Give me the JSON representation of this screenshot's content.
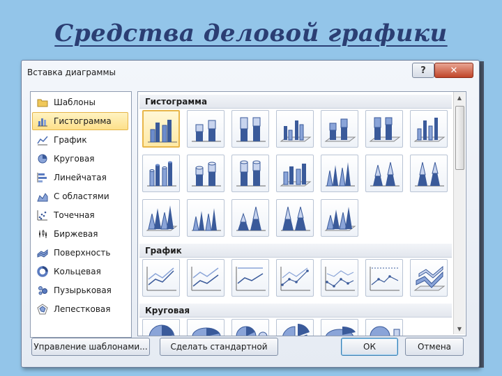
{
  "slide": {
    "title": "Средства деловой графики"
  },
  "dialog": {
    "title": "Вставка диаграммы",
    "help_label": "?",
    "close_label": "✕",
    "categories": [
      {
        "label": "Шаблоны",
        "icon": "folder-icon"
      },
      {
        "label": "Гистограмма",
        "icon": "column-chart-icon",
        "selected": true
      },
      {
        "label": "График",
        "icon": "line-chart-icon"
      },
      {
        "label": "Круговая",
        "icon": "pie-chart-icon"
      },
      {
        "label": "Линейчатая",
        "icon": "bar-chart-icon"
      },
      {
        "label": "С областями",
        "icon": "area-chart-icon"
      },
      {
        "label": "Точечная",
        "icon": "scatter-chart-icon"
      },
      {
        "label": "Биржевая",
        "icon": "stock-chart-icon"
      },
      {
        "label": "Поверхность",
        "icon": "surface-chart-icon"
      },
      {
        "label": "Кольцевая",
        "icon": "doughnut-chart-icon"
      },
      {
        "label": "Пузырьковая",
        "icon": "bubble-chart-icon"
      },
      {
        "label": "Лепестковая",
        "icon": "radar-chart-icon"
      }
    ],
    "sections": [
      {
        "label": "Гистограмма"
      },
      {
        "label": "График"
      },
      {
        "label": "Круговая"
      }
    ],
    "buttons": {
      "manage_templates": "Управление шаблонами...",
      "set_default": "Сделать стандартной",
      "ok": "ОК",
      "cancel": "Отмена"
    },
    "colors": {
      "accent": "#e8b64a",
      "chart_blue": "#4a6cb3"
    }
  }
}
